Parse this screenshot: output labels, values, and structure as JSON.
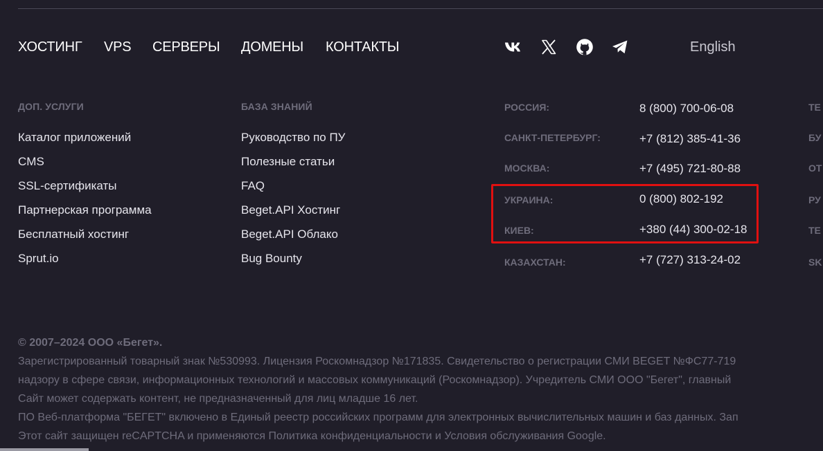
{
  "nav": {
    "items": [
      {
        "label": "ХОСТИНГ"
      },
      {
        "label": "VPS"
      },
      {
        "label": "СЕРВЕРЫ"
      },
      {
        "label": "ДОМЕНЫ"
      },
      {
        "label": "КОНТАКТЫ"
      }
    ]
  },
  "social": {
    "icons": [
      "vk-icon",
      "x-icon",
      "github-icon",
      "telegram-icon"
    ]
  },
  "language": {
    "label": "English"
  },
  "extra_services": {
    "heading": "ДОП. УСЛУГИ",
    "links": [
      "Каталог приложений",
      "CMS",
      "SSL-сертификаты",
      "Партнерская программа",
      "Бесплатный хостинг",
      "Sprut.io"
    ]
  },
  "knowledge_base": {
    "heading": "БАЗА ЗНАНИЙ",
    "links": [
      "Руководство по ПУ",
      "Полезные статьи",
      "FAQ",
      "Beget.API Хостинг",
      "Beget.API Облако",
      "Bug Bounty"
    ]
  },
  "contacts": [
    {
      "region": "РОССИЯ:",
      "phone": "8 (800) 700-06-08"
    },
    {
      "region": "САНКТ-ПЕТЕРБУРГ:",
      "phone": "+7 (812) 385-41-36"
    },
    {
      "region": "МОСКВА:",
      "phone": "+7 (495) 721-80-88"
    },
    {
      "region": "УКРАИНА:",
      "phone": "0 (800) 802-192"
    },
    {
      "region": "КИЕВ:",
      "phone": "+380 (44) 300-02-18"
    },
    {
      "region": "КАЗАХСТАН:",
      "phone": "+7 (727) 313-24-02"
    }
  ],
  "edge_column": [
    "ТЕ",
    "БУ",
    "ОТ",
    "РУ",
    "ТЕ",
    "SK"
  ],
  "footer": {
    "copyright": "© 2007–2024 ООО «Бегет».",
    "lines": [
      "Зарегистрированный товарный знак №530993. Лицензия Роскомнадзор №171835. Свидетельство о регистрации СМИ BEGET №ФС77-719",
      "надзору в сфере связи, информационных технологий и массовых коммуникаций (Роскомнадзор). Учредитель СМИ ООО \"Бегет\", главный",
      "Сайт может содержать контент, не предназначенный для лиц младше 16 лет.",
      "ПО Веб-платформа \"БЕГЕТ\" включено в Единый реестр российских программ для электронных вычислительных машин и баз данных. Зап",
      "Этот сайт защищен reCAPTCHA и применяются Политика конфиденциальности и Условия обслуживания Google."
    ]
  },
  "colors": {
    "background": "#201e29",
    "muted_text": "#6e6c7b",
    "link_text": "#e6e5ec",
    "highlight": "#e01010"
  }
}
